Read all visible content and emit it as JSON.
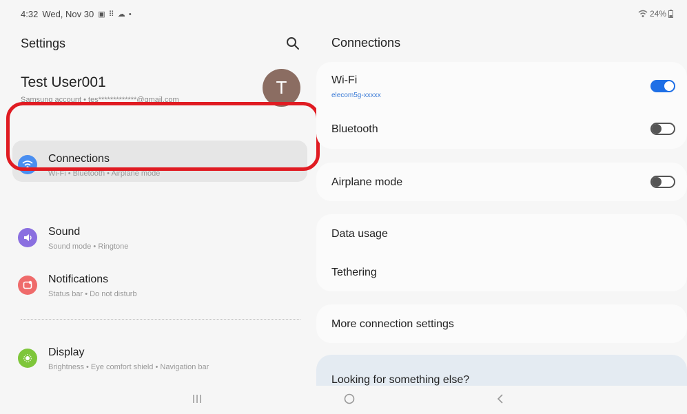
{
  "status_bar": {
    "time": "4:32",
    "date": "Wed, Nov 30",
    "notification_icons": "▣ ⠿ ☁ •",
    "battery": "24%"
  },
  "left": {
    "title": "Settings",
    "profile": {
      "name": "Test User001",
      "subtitle": "Samsung account • tes*************@gmail.com",
      "avatar_letter": "T"
    },
    "items": [
      {
        "title": "Connections",
        "subtitle": "Wi-Fi • Bluetooth • Airplane mode",
        "icon": "wifi-icon",
        "color": "#4a8ef0"
      },
      {
        "title": "Sound",
        "subtitle": "Sound mode • Ringtone",
        "icon": "speaker-icon",
        "color": "#8a6fe0"
      },
      {
        "title": "Notifications",
        "subtitle": "Status bar • Do not disturb",
        "icon": "notification-icon",
        "color": "#ef6b6b"
      },
      {
        "title": "Display",
        "subtitle": "Brightness • Eye comfort shield • Navigation bar",
        "icon": "brightness-icon",
        "color": "#7ec63a"
      }
    ]
  },
  "right": {
    "title": "Connections",
    "wifi": {
      "label": "Wi-Fi",
      "network": "elecom5g-xxxxx",
      "enabled": true
    },
    "bluetooth": {
      "label": "Bluetooth",
      "enabled": false
    },
    "airplane": {
      "label": "Airplane mode",
      "enabled": false
    },
    "data_usage": "Data usage",
    "tethering": "Tethering",
    "more": "More connection settings",
    "suggest": "Looking for something else?"
  },
  "colors": {
    "highlight": "#e01b22",
    "toggle_on": "#1e6fe6"
  }
}
